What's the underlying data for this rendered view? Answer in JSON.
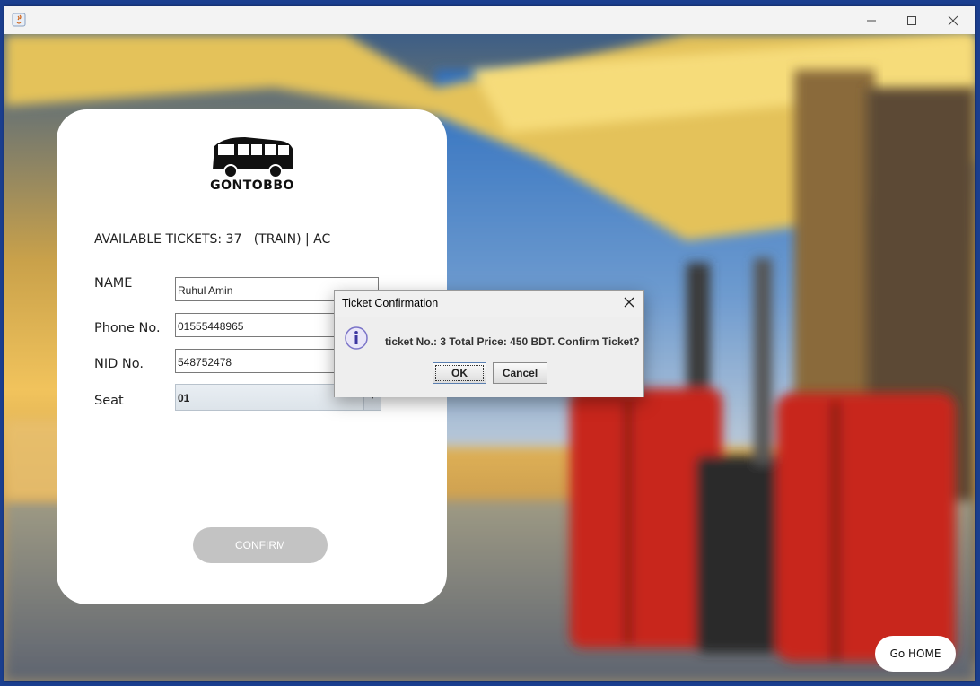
{
  "window": {
    "title": ""
  },
  "panel": {
    "logo_text": "GONTOBBO",
    "available_text": "AVAILABLE TICKETS: 37   (TRAIN) | AC",
    "fields": {
      "name_label": "NAME",
      "name_value": "Ruhul Amin",
      "phone_label": "Phone No.",
      "phone_value": "01555448965",
      "nid_label": "NID No.",
      "nid_value": "548752478",
      "seat_label": "Seat",
      "seat_value": "01"
    },
    "confirm_label": "CONFIRM"
  },
  "home_button": "Go HOME",
  "dialog": {
    "title": "Ticket Confirmation",
    "message": "ticket No.: 3 Total Price: 450 BDT. Confirm Ticket?",
    "ok_label": "OK",
    "cancel_label": "Cancel"
  },
  "colors": {
    "confirm_button": "#c3c3c3",
    "dialog_bg": "#f0f0f0",
    "luggage": "#c8261c"
  }
}
